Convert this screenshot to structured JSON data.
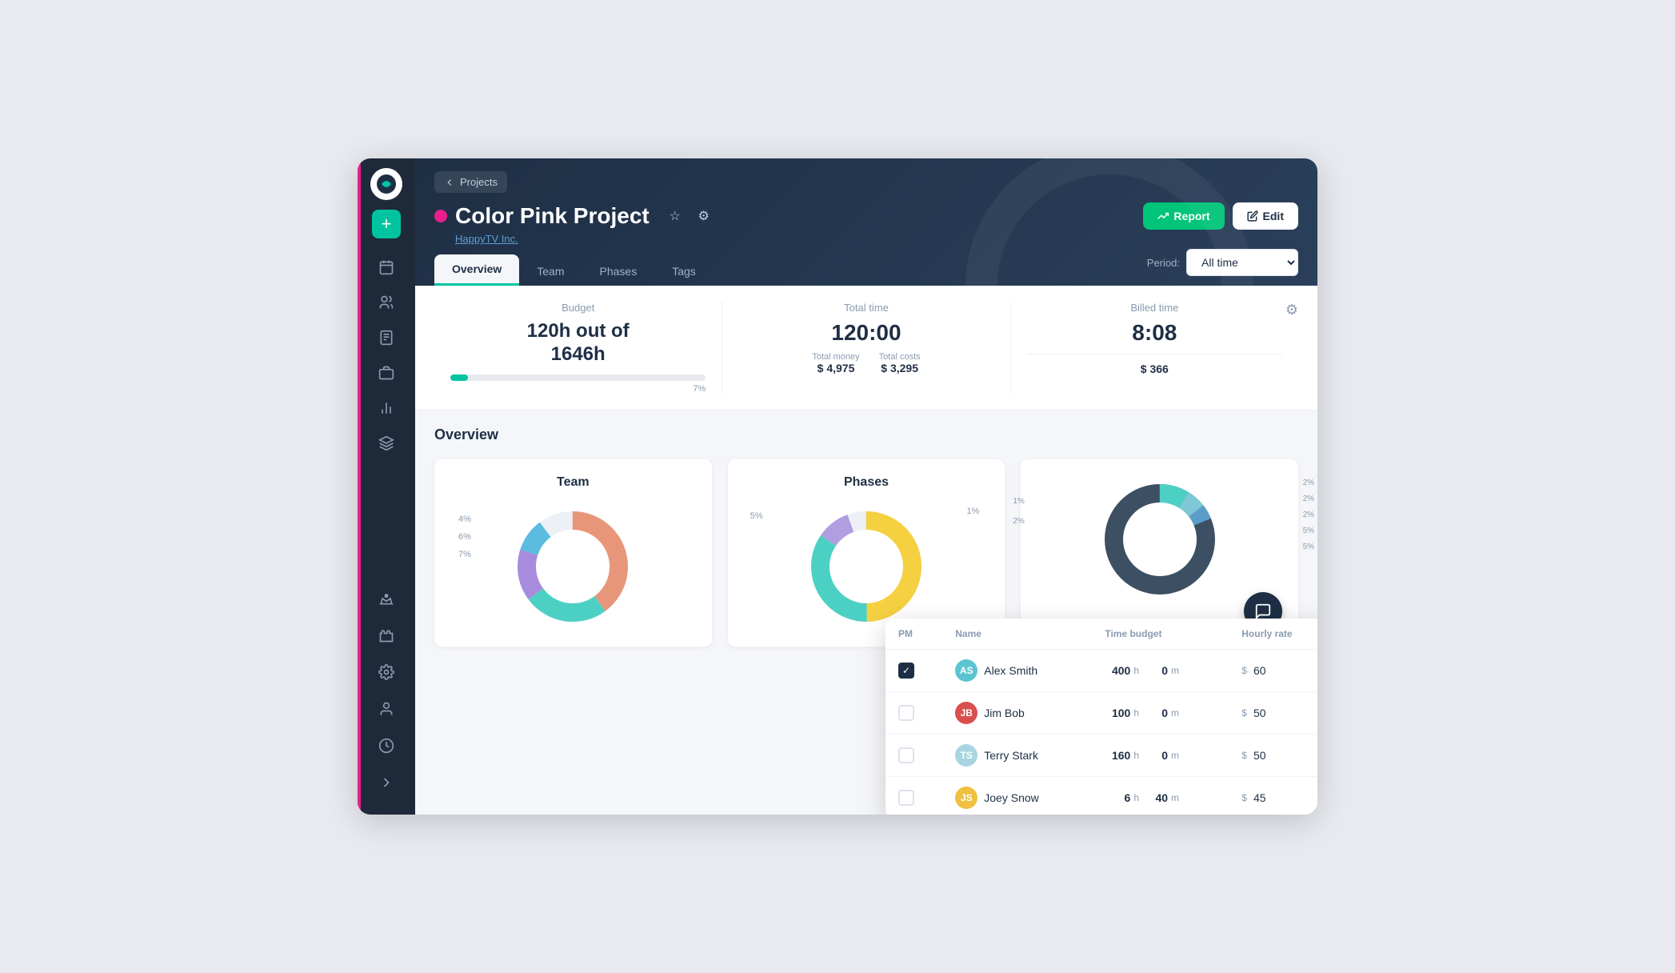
{
  "app": {
    "title": "Color Pink Project"
  },
  "sidebar": {
    "items": [
      {
        "id": "calendar",
        "icon": "calendar"
      },
      {
        "id": "people",
        "icon": "people"
      },
      {
        "id": "documents",
        "icon": "documents"
      },
      {
        "id": "briefcase",
        "icon": "briefcase"
      },
      {
        "id": "chart",
        "icon": "chart"
      },
      {
        "id": "layers",
        "icon": "layers"
      },
      {
        "id": "crown",
        "icon": "crown"
      },
      {
        "id": "puzzle",
        "icon": "puzzle"
      },
      {
        "id": "settings",
        "icon": "settings"
      },
      {
        "id": "person",
        "icon": "person"
      },
      {
        "id": "clock",
        "icon": "clock"
      }
    ]
  },
  "header": {
    "back_label": "Projects",
    "project_dot_color": "#e91e8c",
    "project_title": "Color Pink Project",
    "company": "HappyTV Inc.",
    "report_label": "Report",
    "edit_label": "Edit",
    "tabs": [
      {
        "id": "overview",
        "label": "Overview",
        "active": true
      },
      {
        "id": "team",
        "label": "Team"
      },
      {
        "id": "phases",
        "label": "Phases"
      },
      {
        "id": "tags",
        "label": "Tags"
      }
    ],
    "period_label": "Period:",
    "period_value": "All time"
  },
  "stats": {
    "budget_label": "Budget",
    "budget_value": "120h out of 1646h",
    "budget_pct": "7%",
    "total_time_label": "Total time",
    "total_time_value": "120:00",
    "total_money_label": "Total money",
    "total_money_value": "$ 4,975",
    "total_costs_label": "Total costs",
    "total_costs_value": "$ 3,295",
    "billed_time_label": "Billed time",
    "billed_time_value": "8:08",
    "billed_amount": "$ 366"
  },
  "overview": {
    "section_title": "Overview",
    "team_chart_title": "Team",
    "phases_chart_title": "Phases",
    "team_labels": [
      "4%",
      "6%",
      "7%"
    ],
    "phases_labels": [
      "5%",
      "1%"
    ]
  },
  "team_table": {
    "columns": [
      "PM",
      "Name",
      "Time budget",
      "Hourly rate"
    ],
    "rows": [
      {
        "pm": true,
        "name": "Alex Smith",
        "avatar_color": "#5bc4d1",
        "hours": "400",
        "minutes": "0",
        "rate": "60"
      },
      {
        "pm": false,
        "name": "Jim Bob",
        "avatar_color": "#d94f4f",
        "hours": "100",
        "minutes": "0",
        "rate": "50"
      },
      {
        "pm": false,
        "name": "Terry Stark",
        "avatar_color": "#a8d5e0",
        "hours": "160",
        "minutes": "0",
        "rate": "50"
      },
      {
        "pm": false,
        "name": "Joey Snow",
        "avatar_color": "#f0c040",
        "hours": "6",
        "minutes": "40",
        "rate": "45"
      }
    ]
  }
}
